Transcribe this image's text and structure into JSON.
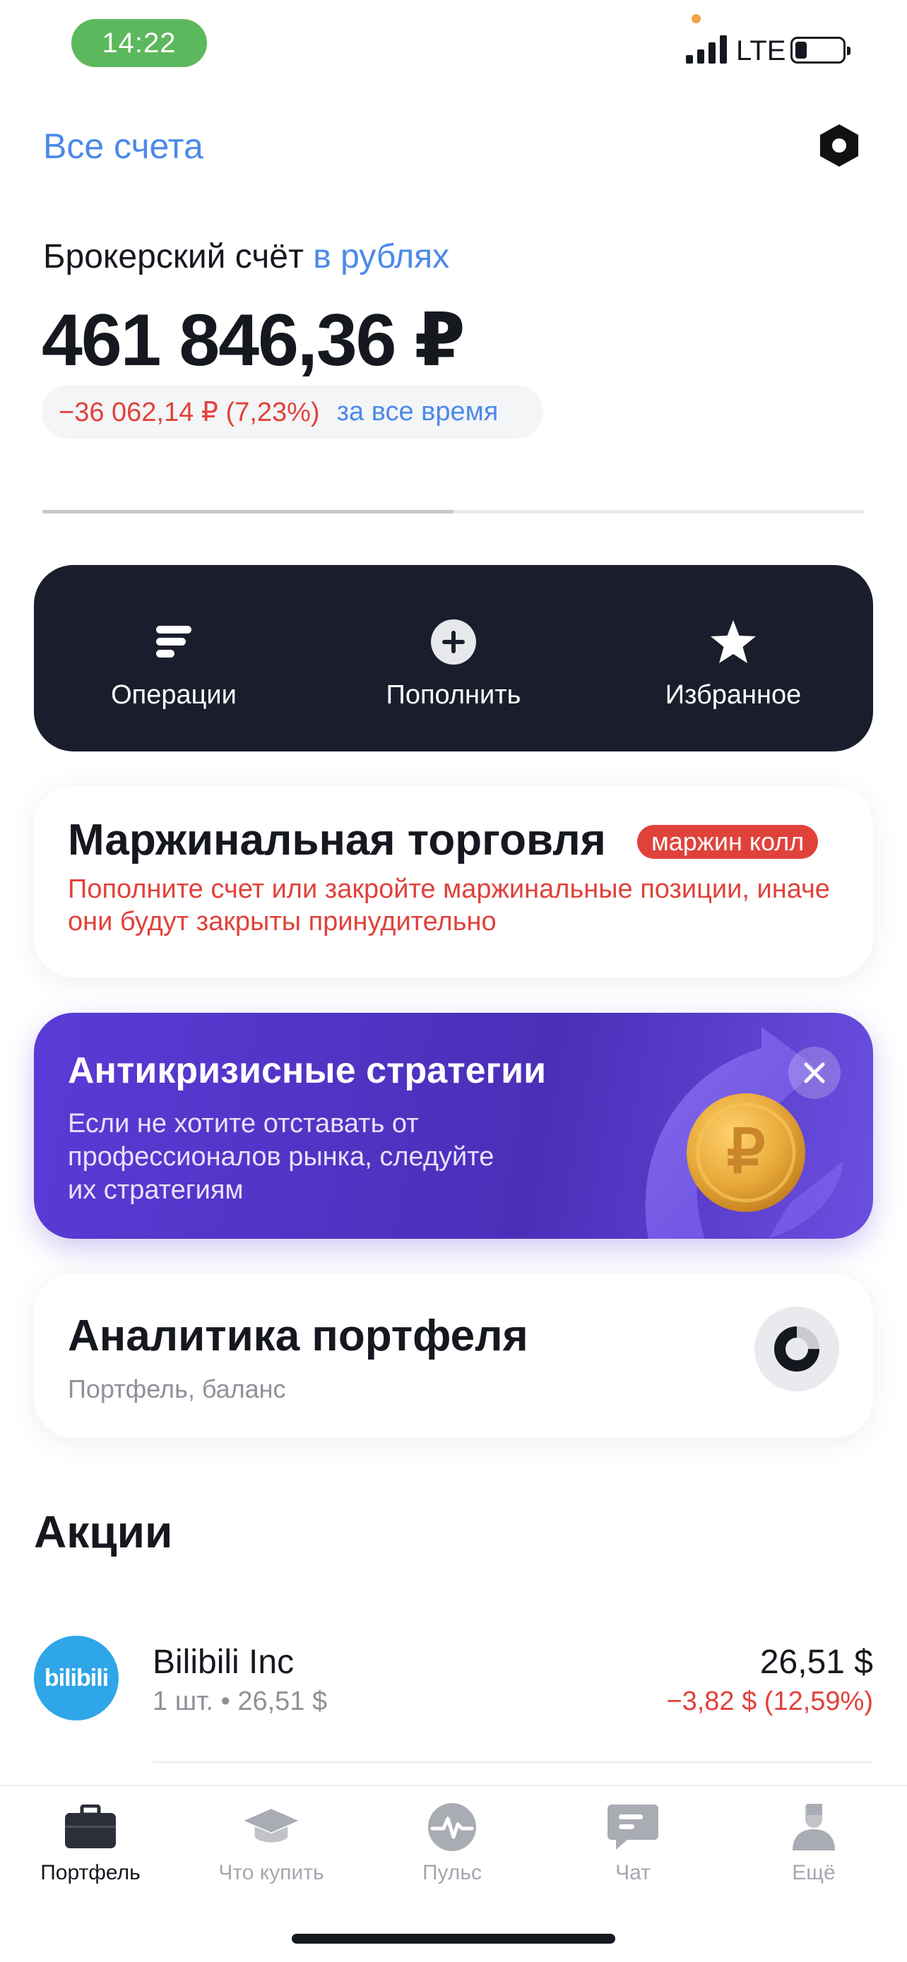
{
  "status_bar": {
    "time": "14:22",
    "network": "LTE"
  },
  "header": {
    "all_accounts_label": "Все счета",
    "settings_icon": "hexagon-settings-icon"
  },
  "account": {
    "title": "Брокерский счёт",
    "currency_link": "в рублях",
    "balance": "461 846,36 ₽",
    "pnl_value": "−36 062,14 ₽ (7,23%)",
    "pnl_period": "за все время",
    "progress_fraction": 0.5
  },
  "actions": [
    {
      "label": "Операции",
      "icon": "operations-icon"
    },
    {
      "label": "Пополнить",
      "icon": "plus-circle-icon"
    },
    {
      "label": "Избранное",
      "icon": "star-icon"
    }
  ],
  "margin_card": {
    "title": "Маржинальная торговля",
    "badge": "маржин колл",
    "text": "Пополните счет или закройте маржинальные позиции, иначе они будут закрыты принудительно"
  },
  "promo": {
    "title": "Антикризисные стратегии",
    "text": "Если не хотите отставать от профессионалов рынка, следуйте их стратегиям",
    "close_icon": "close-icon"
  },
  "analytics": {
    "title": "Аналитика портфеля",
    "subtitle": "Портфель, баланс"
  },
  "stocks": {
    "section_title": "Акции",
    "items": [
      {
        "logo_text": "bilibili",
        "name": "Bilibili Inc",
        "qty": "1 шт. • 26,51 $",
        "price": "26,51 $",
        "change": "−3,82 $ (12,59%)"
      }
    ]
  },
  "tabbar": {
    "items": [
      {
        "label": "Портфель",
        "icon": "briefcase-icon",
        "active": true
      },
      {
        "label": "Что купить",
        "icon": "graduation-cap-icon",
        "active": false
      },
      {
        "label": "Пульс",
        "icon": "pulse-icon",
        "active": false
      },
      {
        "label": "Чат",
        "icon": "chat-icon",
        "active": false
      },
      {
        "label": "Ещё",
        "icon": "more-user-icon",
        "active": false
      }
    ]
  },
  "colors": {
    "accent_blue": "#4b8ae8",
    "negative_red": "#e0423b",
    "dark_panel": "#1a1e2c",
    "promo_purple": "#5a3bd6"
  }
}
